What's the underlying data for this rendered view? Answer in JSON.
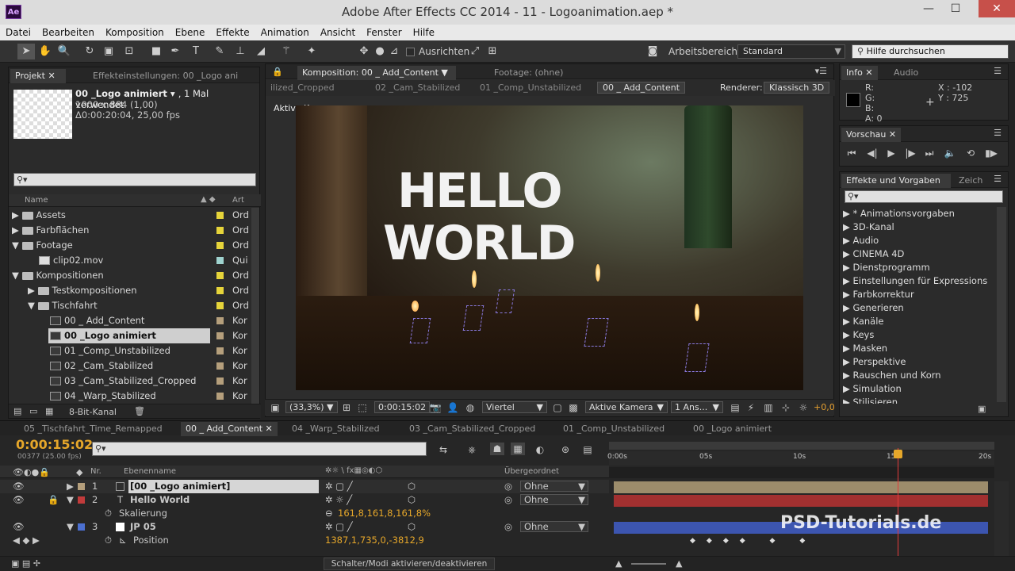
{
  "window": {
    "title": "Adobe After Effects CC 2014 - 11 - Logoanimation.aep *",
    "app_badge": "Ae"
  },
  "menu": [
    "Datei",
    "Bearbeiten",
    "Komposition",
    "Ebene",
    "Effekte",
    "Animation",
    "Ansicht",
    "Fenster",
    "Hilfe"
  ],
  "toolbar": {
    "align_label": "Ausrichten",
    "workspace_label": "Arbeitsbereich:",
    "workspace_value": "Standard",
    "help_placeholder": "Hilfe durchsuchen"
  },
  "project": {
    "tab_project": "Projekt",
    "tab_effects": "Effekteinstellungen: 00 _Logo ani",
    "selected_name": "00 _Logo animiert",
    "used": ", 1 Mal verwendet",
    "dims": "1000 x 884 (1,00)",
    "duration": "Δ0:00:20:04, 25,00 fps",
    "col_name": "Name",
    "col_type": "Art",
    "items": [
      {
        "name": "Assets",
        "type": "Ord",
        "color": "#e6d43a"
      },
      {
        "name": "Farbflächen",
        "type": "Ord",
        "color": "#e6d43a"
      },
      {
        "name": "Footage",
        "type": "Ord",
        "color": "#e6d43a"
      },
      {
        "name": "clip02.mov",
        "type": "Qui",
        "color": "#9fd3cf"
      },
      {
        "name": "Kompositionen",
        "type": "Ord",
        "color": "#e6d43a"
      },
      {
        "name": "Testkompositionen",
        "type": "Ord",
        "color": "#e6d43a"
      },
      {
        "name": "Tischfahrt",
        "type": "Ord",
        "color": "#e6d43a"
      },
      {
        "name": "00 _ Add_Content",
        "type": "Kor",
        "color": "#b59f7c"
      },
      {
        "name": "00 _Logo animiert",
        "type": "Kor",
        "color": "#b59f7c"
      },
      {
        "name": "01 _Comp_Unstabilized",
        "type": "Kor",
        "color": "#b59f7c"
      },
      {
        "name": "02 _Cam_Stabilized",
        "type": "Kor",
        "color": "#b59f7c"
      },
      {
        "name": "03 _Cam_Stabilized_Cropped",
        "type": "Kor",
        "color": "#b59f7c"
      },
      {
        "name": "04 _Warp_Stabilized",
        "type": "Kor",
        "color": "#b59f7c"
      }
    ],
    "bit_depth": "8-Bit-Kanal"
  },
  "composition": {
    "tab_label": "Komposition: 00 _ Add_Content",
    "footage_tab": "Footage: (ohne)",
    "breadcrumbs": [
      "ilized_Cropped",
      "02 _Cam_Stabilized",
      "01 _Comp_Unstabilized",
      "00 _ Add_Content"
    ],
    "renderer_label": "Renderer:",
    "renderer_value": "Klassisch 3D",
    "camera_label": "Aktive Kamera",
    "hello": "HELLO",
    "world": "WORLD",
    "zoom": "(33,3%)",
    "timecode": "0:00:15:02",
    "resolution": "Viertel",
    "camera_select": "Aktive Kamera",
    "views": "1 Ans...",
    "exposure": "+0,0"
  },
  "info": {
    "tab_info": "Info",
    "tab_audio": "Audio",
    "r": "R:",
    "g": "G:",
    "b": "B:",
    "a": "A:  0",
    "x": "X : -102",
    "y": "Y : 725"
  },
  "preview": {
    "tab": "Vorschau"
  },
  "effects": {
    "tab": "Effekte und Vorgaben",
    "tab2": "Zeich",
    "items": [
      "* Animationsvorgaben",
      "3D-Kanal",
      "Audio",
      "CINEMA 4D",
      "Dienstprogramm",
      "Einstellungen für Expressions",
      "Farbkorrektur",
      "Generieren",
      "Kanäle",
      "Keys",
      "Masken",
      "Perspektive",
      "Rauschen und Korn",
      "Simulation",
      "Stilisieren"
    ]
  },
  "timeline": {
    "tabs": [
      "05 _Tischfahrt_Time_Remapped",
      "00 _ Add_Content",
      "04 _Warp_Stabilized",
      "03 _Cam_Stabilized_Cropped",
      "01 _Comp_Unstabilized",
      "00 _Logo animiert"
    ],
    "timecode": "0:00:15:02",
    "frames": "00377 (25.00 fps)",
    "col_nr": "Nr.",
    "col_name": "Ebenenname",
    "col_parent": "Übergeordnet",
    "ruler": [
      "0:00s",
      "05s",
      "10s",
      "15s",
      "20s"
    ],
    "layers": [
      {
        "nr": "1",
        "name": "[00 _Logo animiert]",
        "parent": "Ohne",
        "label": "#b59f7c"
      },
      {
        "nr": "2",
        "name": "Hello World",
        "parent": "Ohne",
        "label": "#c23b3b"
      },
      {
        "nr": "",
        "name": "Skalierung",
        "value": "161,8,161,8,161,8%"
      },
      {
        "nr": "3",
        "name": "JP 05",
        "parent": "Ohne",
        "label": "#4b6fd0"
      },
      {
        "nr": "",
        "name": "Position",
        "value": "1387,1,735,0,-3812,9"
      }
    ],
    "toggle_label": "Schalter/Modi aktivieren/deaktivieren",
    "watermark": "PSD-Tutorials.de",
    "time_fraction": 0.755
  }
}
